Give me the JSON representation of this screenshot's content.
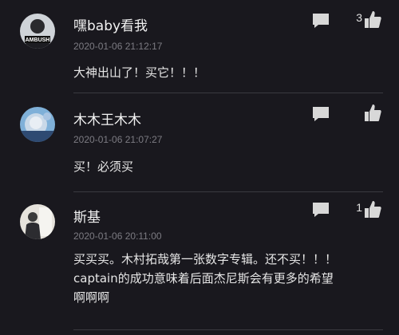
{
  "comments": [
    {
      "username": "嘿baby看我",
      "timestamp": "2020-01-06 21:12:17",
      "lines": [
        "大神出山了！买它！！！"
      ],
      "likes": "3",
      "avatar_text": "AMBUSH"
    },
    {
      "username": "木木王木木",
      "timestamp": "2020-01-06 21:07:27",
      "lines": [
        "买！必须买"
      ],
      "likes": ""
    },
    {
      "username": "斯基",
      "timestamp": "2020-01-06 20:11:00",
      "lines": [
        "买买买。木村拓哉第一张数字专辑。还不买！！！",
        "captain的成功意味着后面杰尼斯会有更多的希望",
        "啊啊啊"
      ],
      "likes": "1"
    }
  ],
  "icons": {
    "reply": "comment-bubble-icon",
    "like": "thumbs-up-icon"
  },
  "colors": {
    "background": "#19181e",
    "divider": "#3a3a40",
    "timestamp": "#7c7b82",
    "icon": "#d8d8d8"
  }
}
